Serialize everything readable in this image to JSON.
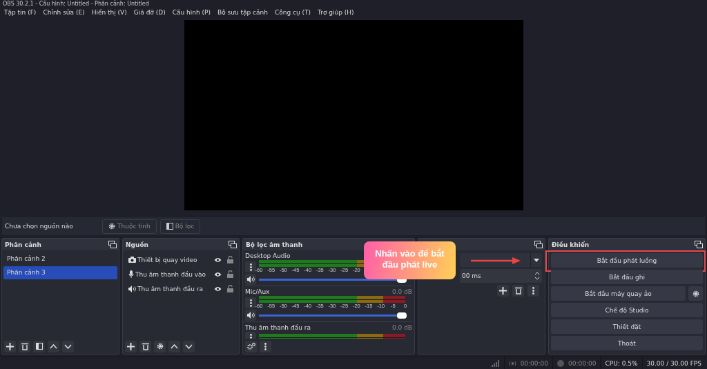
{
  "window": {
    "title": "OBS 30.2.1 - Cấu hình: Untitled - Phân cảnh: Untitled"
  },
  "menu": [
    "Tập tin (F)",
    "Chỉnh sửa (E)",
    "Hiển thị (V)",
    "Giá đỡ (D)",
    "Cấu hình (P)",
    "Bộ sưu tập cảnh",
    "Công cụ (T)",
    "Trợ giúp (H)"
  ],
  "source_bar": {
    "status": "Chưa chọn nguồn nào",
    "buttons": [
      {
        "kind": "gear",
        "label": "Thuộc tính"
      },
      {
        "kind": "filter",
        "label": "Bộ lọc"
      }
    ]
  },
  "scenes": {
    "title": "Phân cảnh",
    "items": [
      {
        "label": "Phân cảnh 2",
        "selected": false
      },
      {
        "label": "Phân cảnh 3",
        "selected": true
      }
    ]
  },
  "sources": {
    "title": "Nguồn",
    "items": [
      {
        "kind": "camera",
        "label": "Thiết bị quay video"
      },
      {
        "kind": "mic",
        "label": "Thu âm thanh đầu vào"
      },
      {
        "kind": "speaker",
        "label": "Thu âm thanh đầu ra"
      }
    ]
  },
  "mixer": {
    "title": "Bộ lọc âm thanh",
    "channels": [
      {
        "name": "Desktop Audio",
        "scale": [
          "-60",
          "-55",
          "-50",
          "-45",
          "-40",
          "-35",
          "-30",
          "-25",
          "-20"
        ],
        "level": 1
      },
      {
        "name": "Mic/Aux",
        "reading": "0.0 dB",
        "scale": [
          "-60",
          "-55",
          "-50",
          "-45",
          "-40",
          "-35",
          "-30",
          "-25",
          "-20",
          "-15",
          "-10",
          "-5",
          "0"
        ],
        "level": 1
      },
      {
        "name": "Thu âm thanh đầu ra",
        "reading": "0.0 dB"
      }
    ]
  },
  "transitions": {
    "duration": "00 ms"
  },
  "controls": {
    "title": "Điều khiển",
    "buttons": [
      {
        "label": "Bắt đầu phát luồng",
        "highlighted": true
      },
      {
        "label": "Bắt đầu ghi",
        "highlighted": false
      },
      {
        "label": "Bắt đầu máy quay ảo",
        "highlighted": false,
        "settings": true
      },
      {
        "label": "Chế độ Studio",
        "highlighted": false
      },
      {
        "label": "Thiết đặt",
        "highlighted": false
      },
      {
        "label": "Thoát",
        "highlighted": false
      }
    ]
  },
  "callout": {
    "text": "Nhấn vào để bắt đầu phát live"
  },
  "status_bar": {
    "stream_time": "00:00:00",
    "record_time": "00:00:00",
    "cpu": "CPU: 0.5%",
    "fps": "30.00 / 30.00 FPS"
  }
}
